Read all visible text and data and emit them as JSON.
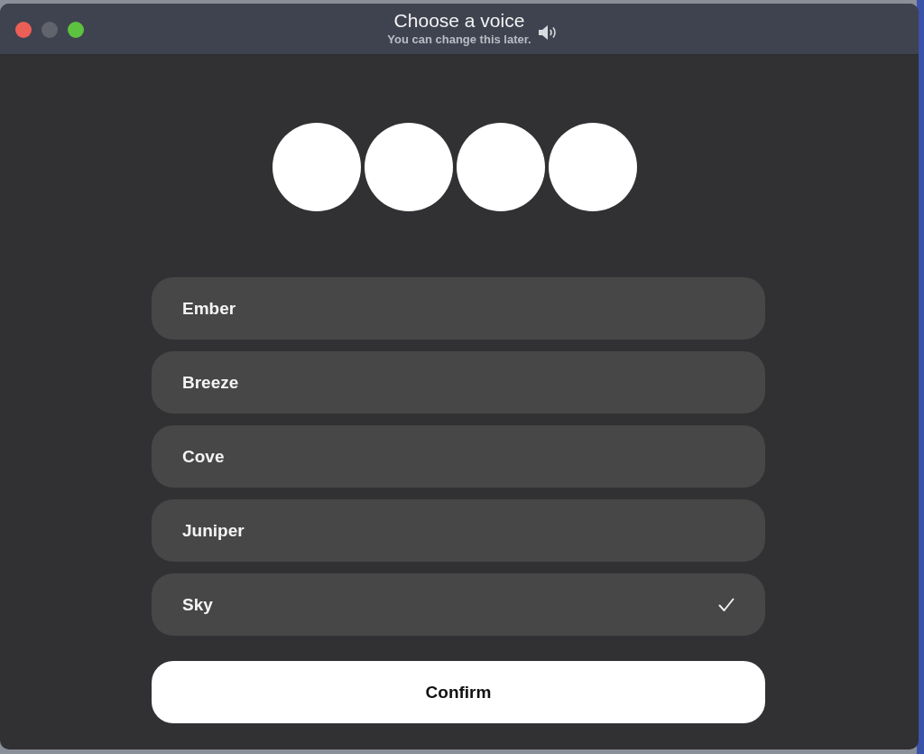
{
  "window": {
    "title": "Choose a voice",
    "subtitle": "You can change this later."
  },
  "voices": [
    {
      "name": "Ember",
      "selected": false
    },
    {
      "name": "Breeze",
      "selected": false
    },
    {
      "name": "Cove",
      "selected": false
    },
    {
      "name": "Juniper",
      "selected": false
    },
    {
      "name": "Sky",
      "selected": true
    }
  ],
  "confirm_button": "Confirm"
}
